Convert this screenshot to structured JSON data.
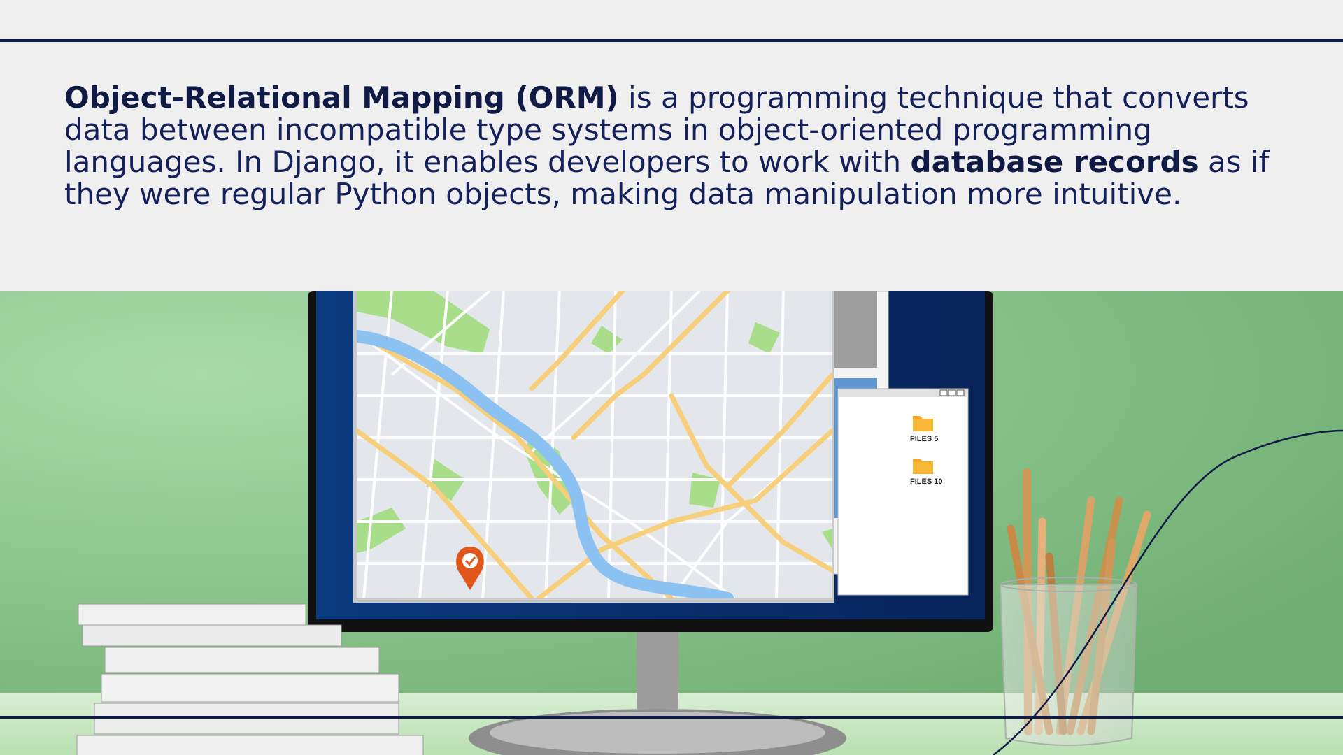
{
  "paragraph": {
    "term": "Object-Relational Mapping (ORM)",
    "part1": " is a programming technique that converts data between incompatible type systems in object-oriented programming languages. In Django, it enables developers to work with ",
    "emphasis": "database records",
    "part2": " as if they were regular Python objects, making data manipulation more intuitive."
  },
  "illustration": {
    "folders": [
      {
        "label": "FILES 5",
        "icon": "folder-icon"
      },
      {
        "label": "FILES 10",
        "icon": "folder-icon"
      }
    ],
    "map_marker_icon": "location-pin-icon",
    "window_controls_icon": "window-controls-icon"
  },
  "colors": {
    "navy": "#0f1a45",
    "background": "#efefef",
    "wall_green": "#8fc98f",
    "monitor_bezel": "#0b2a66",
    "map_road": "#f7cf7a",
    "map_river": "#8cc2f2",
    "map_park": "#a8de8a",
    "pin": "#e0561b",
    "folder": "#f5a623"
  }
}
